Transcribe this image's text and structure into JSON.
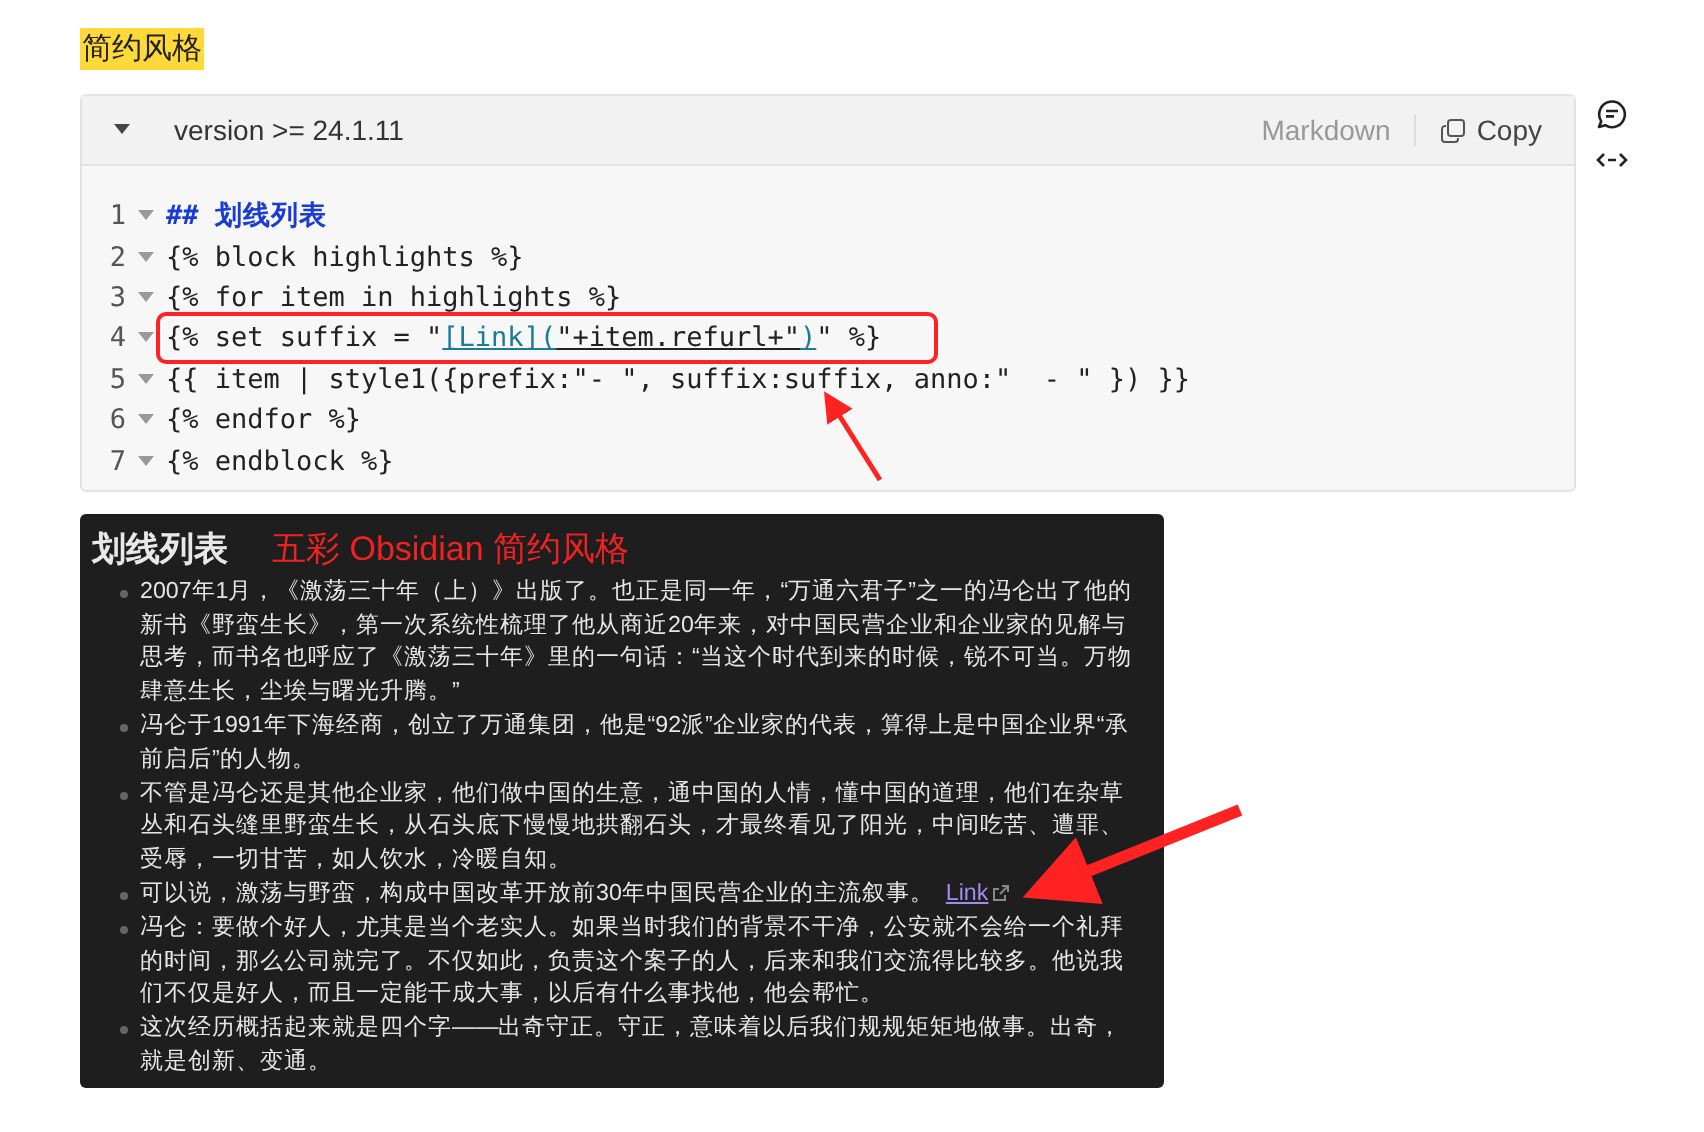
{
  "heading": "简约风格",
  "code_block": {
    "title": "version >= 24.1.11",
    "language": "Markdown",
    "copy_label": "Copy",
    "lines": [
      {
        "number": "1",
        "boxed": false,
        "tokens": [
          {
            "text": "## 划线列表",
            "kind": "heading"
          }
        ]
      },
      {
        "number": "2",
        "boxed": false,
        "tokens": [
          {
            "text": "{% block highlights %}",
            "kind": "plain"
          }
        ]
      },
      {
        "number": "3",
        "boxed": false,
        "tokens": [
          {
            "text": "{% for item in highlights %}",
            "kind": "plain"
          }
        ]
      },
      {
        "number": "4",
        "boxed": true,
        "tokens": [
          {
            "text": "{% set suffix = \"",
            "kind": "plain"
          },
          {
            "text": "[Link](",
            "kind": "link"
          },
          {
            "text": "\"+item.refurl+\"",
            "kind": "url"
          },
          {
            "text": ")",
            "kind": "link"
          },
          {
            "text": "\" %}",
            "kind": "plain"
          }
        ]
      },
      {
        "number": "5",
        "boxed": false,
        "tokens": [
          {
            "text": "{{ item | style1({prefix:\"- \", suffix:suffix, anno:\"  - \" }) }}",
            "kind": "plain"
          }
        ]
      },
      {
        "number": "6",
        "boxed": false,
        "tokens": [
          {
            "text": "{% endfor %}",
            "kind": "plain"
          }
        ]
      },
      {
        "number": "7",
        "boxed": false,
        "tokens": [
          {
            "text": "{% endblock %}",
            "kind": "plain"
          }
        ]
      }
    ]
  },
  "preview": {
    "title": "划线列表",
    "annotation": "五彩 Obsidian 简约风格",
    "items": [
      {
        "text": "2007年1月，《激荡三十年（上）》出版了。也正是同一年，“万通六君子”之一的冯仑出了他的新书《野蛮生长》，第一次系统性梳理了他从商近20年来，对中国民营企业和企业家的见解与思考，而书名也呼应了《激荡三十年》里的一句话：“当这个时代到来的时候，锐不可当。万物肆意生长，尘埃与曙光升腾。”"
      },
      {
        "text": "冯仑于1991年下海经商，创立了万通集团，他是“92派”企业家的代表，算得上是中国企业界“承前启后”的人物。"
      },
      {
        "text": "不管是冯仑还是其他企业家，他们做中国的生意，通中国的人情，懂中国的道理，他们在杂草丛和石头缝里野蛮生长，从石头底下慢慢地拱翻石头，才最终看见了阳光，中间吃苦、遭罪、受辱，一切甘苦，如人饮水，冷暖自知。"
      },
      {
        "text": "可以说，激荡与野蛮，构成中国改革开放前30年中国民营企业的主流叙事。",
        "link": "Link"
      },
      {
        "text": "冯仑：要做个好人，尤其是当个老实人。如果当时我们的背景不干净，公安就不会给一个礼拜的时间，那么公司就完了。不仅如此，负责这个案子的人，后来和我们交流得比较多。他说我们不仅是好人，而且一定能干成大事，以后有什么事找他，他会帮忙。"
      },
      {
        "text": "这次经历概括起来就是四个字——出奇守正。守正，意味着以后我们规规矩矩地做事。出奇，就是创新、变通。"
      }
    ]
  }
}
